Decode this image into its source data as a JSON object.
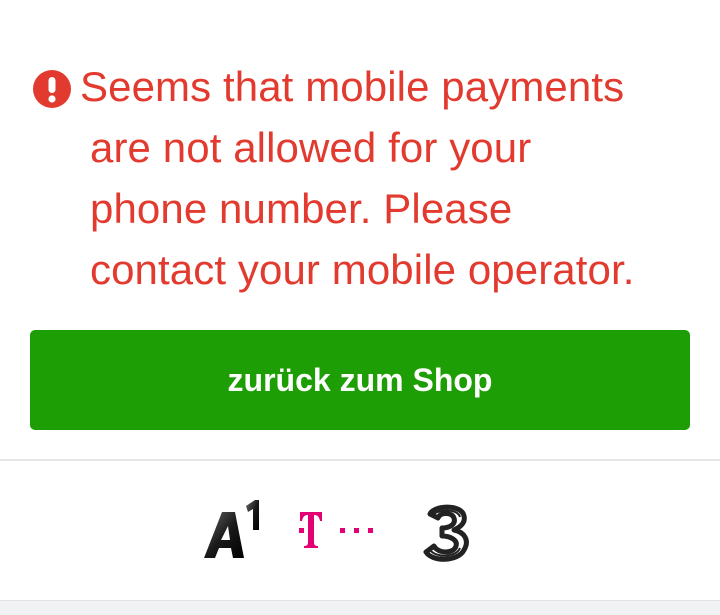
{
  "error": {
    "icon": "exclamation-circle-icon",
    "color": "#e23a2e",
    "lines": [
      "Seems that mobile payments",
      "are not allowed for your",
      "phone number. Please",
      "contact your mobile operator."
    ]
  },
  "button": {
    "label": "zurück zum Shop",
    "color": "#1e9e05"
  },
  "operators": {
    "logos": [
      {
        "name": "A1",
        "icon": "a1-logo"
      },
      {
        "name": "T",
        "icon": "telekom-logo"
      },
      {
        "name": "3",
        "icon": "three-logo"
      }
    ]
  }
}
